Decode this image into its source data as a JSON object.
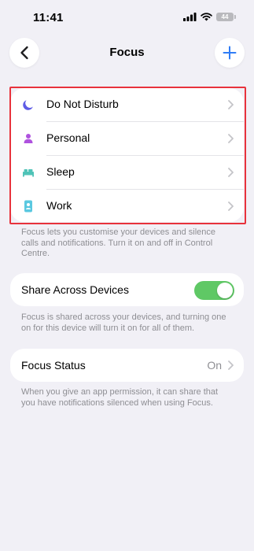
{
  "status_bar": {
    "time": "11:41",
    "battery": "44"
  },
  "nav": {
    "title": "Focus",
    "back_icon": "chevron-left-icon",
    "add_icon": "plus-icon",
    "accent": "#2f7cf6"
  },
  "focus_modes": [
    {
      "label": "Do Not Disturb",
      "icon": "moon-icon",
      "color": "#5e5ce6"
    },
    {
      "label": "Personal",
      "icon": "person-icon",
      "color": "#af52de"
    },
    {
      "label": "Sleep",
      "icon": "bed-icon",
      "color": "#4fc3b7"
    },
    {
      "label": "Work",
      "icon": "id-badge-icon",
      "color": "#5ac8e0"
    }
  ],
  "focus_note": "Focus lets you customise your devices and silence calls and notifications. Turn it on and off in Control Centre.",
  "share": {
    "label": "Share Across Devices",
    "enabled": true,
    "toggle_color": "#5fc865"
  },
  "share_note": "Focus is shared across your devices, and turning one on for this device will turn it on for all of them.",
  "focus_status": {
    "label": "Focus Status",
    "value": "On"
  },
  "status_note": "When you give an app permission, it can share that you have notifications silenced when using Focus."
}
